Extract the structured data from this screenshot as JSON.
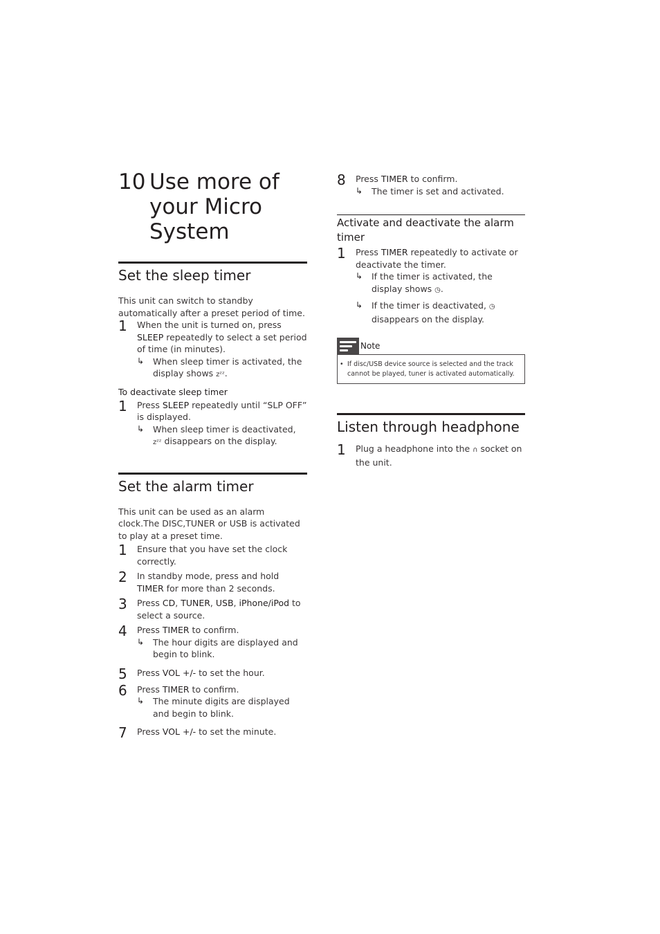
{
  "chapter": {
    "number": "10",
    "title_lines": [
      "Use more of",
      "your Micro",
      "System"
    ]
  },
  "sleep": {
    "heading": "Set the sleep timer",
    "intro": "This unit can switch to standby automatically after a preset period of time.",
    "step1": {
      "n": "1",
      "pre": "When the unit is turned on, press ",
      "key": "SLEEP",
      "post": " repeatedly to select a set period of time (in minutes).",
      "result_pre": "When sleep timer is activated, the display shows ",
      "icon": "zᶻᶻ",
      "result_post": "."
    },
    "deactivate_heading": "To deactivate sleep timer",
    "dstep1": {
      "n": "1",
      "pre": "Press ",
      "key": "SLEEP",
      "post": " repeatedly until “SLP OFF” is displayed.",
      "result_pre": "When sleep timer is deactivated, ",
      "icon": "zᶻᶻ",
      "result_post": " disappears on the display."
    }
  },
  "alarm": {
    "heading": "Set the alarm timer",
    "intro": "This unit can be used as an alarm clock.The DISC,TUNER or USB is activated to play at a preset time.",
    "steps": [
      {
        "n": "1",
        "text": "Ensure that you have set the clock correctly."
      },
      {
        "n": "2",
        "pre": "In standby mode, press and hold ",
        "key": "TIMER",
        "post": " for more than 2 seconds."
      },
      {
        "n": "3",
        "pre": "Press ",
        "keys": [
          "CD",
          "TUNER",
          "USB",
          "iPhone/iPod"
        ],
        "post": " to select a source."
      },
      {
        "n": "4",
        "pre": "Press ",
        "key": "TIMER",
        "post": " to confirm.",
        "result": "The hour digits are displayed and begin to blink."
      },
      {
        "n": "5",
        "pre": "Press ",
        "key": "VOL +/-",
        "post": " to set the hour."
      },
      {
        "n": "6",
        "pre": "Press ",
        "key": "TIMER",
        "post": " to confirm.",
        "result": "The minute digits are displayed and begin to blink."
      },
      {
        "n": "7",
        "pre": "Press ",
        "key": "VOL +/-",
        "post": " to set the minute."
      },
      {
        "n": "8",
        "pre": "Press ",
        "key": "TIMER",
        "post": " to confirm.",
        "result": "The timer is set and activated."
      }
    ]
  },
  "activate": {
    "heading": "Activate and deactivate the alarm timer",
    "step1": {
      "n": "1",
      "pre": "Press ",
      "key": "TIMER",
      "post": " repeatedly to activate or deactivate the timer.",
      "result1_pre": "If the timer is activated, the display shows ",
      "icon": "◷",
      "result1_post": ".",
      "result2_pre": "If the timer is deactivated, ",
      "result2_post": " disappears on the display."
    }
  },
  "note": {
    "label": "Note",
    "bullet": "•",
    "text": "If disc/USB device source is selected and the track cannot be played, tuner is activated automatically."
  },
  "headphone": {
    "heading": "Listen through headphone",
    "step1": {
      "n": "1",
      "pre": "Plug a headphone into the ",
      "icon": "∩",
      "post": " socket on the unit."
    }
  },
  "arrow": "↳"
}
